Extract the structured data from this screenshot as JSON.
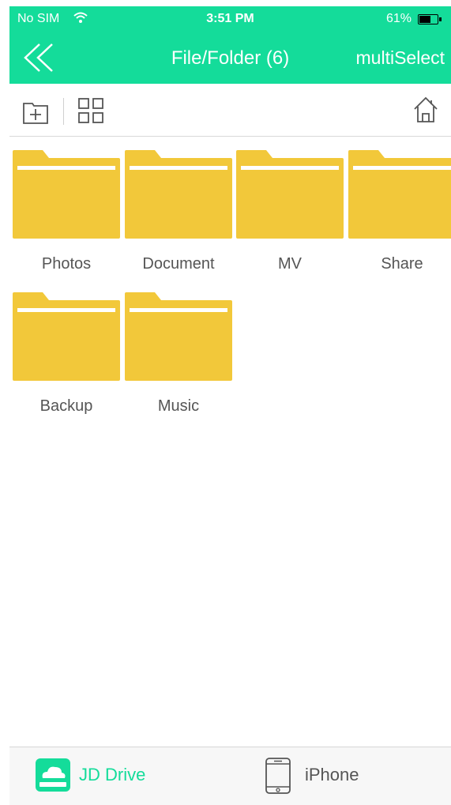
{
  "status_bar": {
    "carrier": "No SIM",
    "time": "3:51 PM",
    "battery": "61%"
  },
  "nav": {
    "back_icon": "double-chevron-left-icon",
    "title": "File/Folder (6)",
    "multiselect_label": "multiSelect"
  },
  "toolbar": {
    "new_folder_icon": "new-folder-icon",
    "grid_view_icon": "grid-view-icon",
    "home_icon": "home-icon"
  },
  "folders": [
    {
      "name": "Photos"
    },
    {
      "name": "Document"
    },
    {
      "name": "MV"
    },
    {
      "name": "Share"
    },
    {
      "name": "Backup"
    },
    {
      "name": "Music"
    }
  ],
  "tabs": [
    {
      "label": "JD Drive",
      "icon": "cloud-drive-icon",
      "active": true
    },
    {
      "label": "iPhone",
      "icon": "phone-icon",
      "active": false
    }
  ],
  "colors": {
    "accent": "#14dc9a",
    "folder": "#f2c83a",
    "folder_stripe": "#ffffff",
    "inactive_tab": "#555555"
  }
}
